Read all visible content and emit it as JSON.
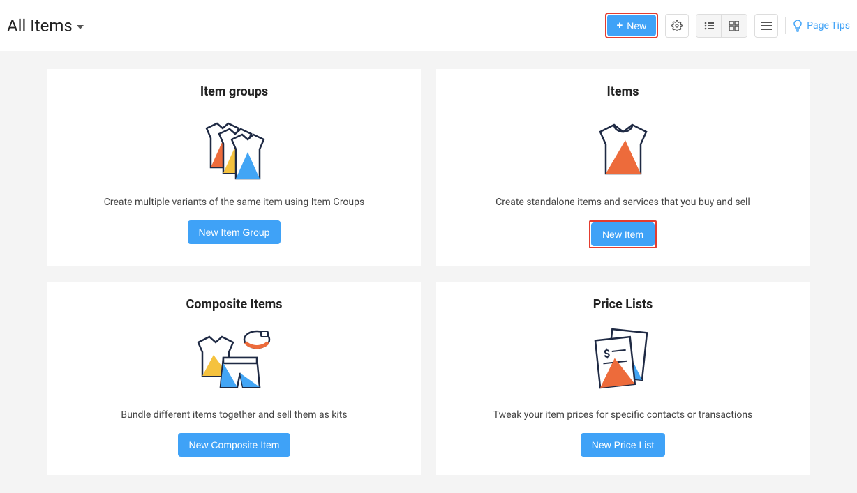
{
  "header": {
    "title": "All Items",
    "new_label": "New",
    "page_tips_label": "Page Tips"
  },
  "cards": {
    "item_groups": {
      "title": "Item groups",
      "desc": "Create multiple variants of the same item using Item Groups",
      "button": "New Item Group"
    },
    "items": {
      "title": "Items",
      "desc": "Create standalone items and services that you buy and sell",
      "button": "New Item"
    },
    "composite": {
      "title": "Composite Items",
      "desc": "Bundle different items together and sell them as kits",
      "button": "New Composite Item"
    },
    "price_lists": {
      "title": "Price Lists",
      "desc": "Tweak your item prices for specific contacts or transactions",
      "button": "New Price List"
    }
  },
  "colors": {
    "accent": "#3fa2f7",
    "highlight": "#e43c2f",
    "orange": "#ed6b3b",
    "yellow": "#f5c23e",
    "blue": "#42a5f5"
  }
}
